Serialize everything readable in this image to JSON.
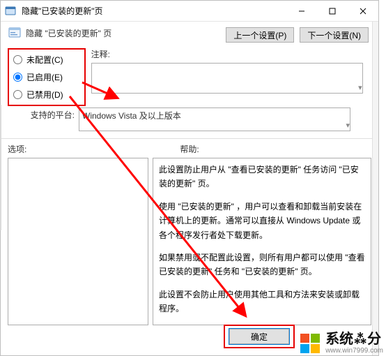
{
  "titlebar": {
    "title": "隐藏\"已安装的更新\"页"
  },
  "subtitle": "隐藏 \"已安装的更新\" 页",
  "nav": {
    "prev": "上一个设置(P)",
    "next": "下一个设置(N)"
  },
  "radios": {
    "not_configured": "未配置(C)",
    "enabled": "已启用(E)",
    "disabled": "已禁用(D)",
    "selected": "enabled"
  },
  "labels": {
    "comment": "注释:",
    "platform": "支持的平台:",
    "options": "选项:",
    "help": "帮助:"
  },
  "platform_text": "Windows Vista 及以上版本",
  "help_paragraphs": [
    "此设置防止用户从 \"查看已安装的更新\" 任务访问 \"已安装的更新\" 页。",
    "使用 \"已安装的更新\" ，用户可以查看和卸载当前安装在计算机上的更新。通常可以直接从 Windows Update 或各个程序发行者处下载更新。",
    "如果禁用或不配置此设置，则所有用户都可以使用 \"查看已安装的更新\" 任务和 \"已安装的更新\" 页。",
    "此设置不会防止用户使用其他工具和方法来安装或卸载程序。"
  ],
  "buttons": {
    "ok": "确定"
  },
  "watermark": {
    "brand": "系统⁂分",
    "url": "www.win7999.com"
  },
  "arrows_color": "#ff0000"
}
